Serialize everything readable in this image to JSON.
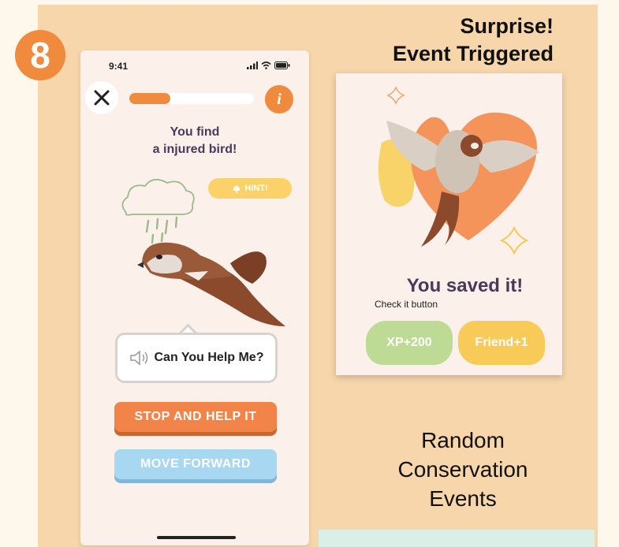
{
  "step_number": "8",
  "phone": {
    "status_time": "9:41",
    "progress_fraction": 0.33,
    "info_label": "i",
    "prompt_line1": "You find",
    "prompt_line2": "a injured bird!",
    "hint_label": "HINT!",
    "help_label": "Can You Help Me?",
    "stop_button": "STOP AND HELP IT",
    "move_button": "MOVE FORWARD"
  },
  "surprise": {
    "line1": "Surprise!",
    "line2": "Event Triggered"
  },
  "event_card": {
    "saved_title": "You saved it!",
    "check_label": "Check it button",
    "xp_reward": "XP+200",
    "friend_reward": "Friend+1"
  },
  "caption": {
    "line1": "Random",
    "line2": "Conservation",
    "line3": "Events"
  },
  "colors": {
    "panel": "#f7d6ab",
    "accent_orange": "#f08a3c",
    "blue_button": "#a8d7f2",
    "hint_yellow": "#fcd16a",
    "xp_green": "#bedb96",
    "friend_yellow": "#f8ca58"
  }
}
